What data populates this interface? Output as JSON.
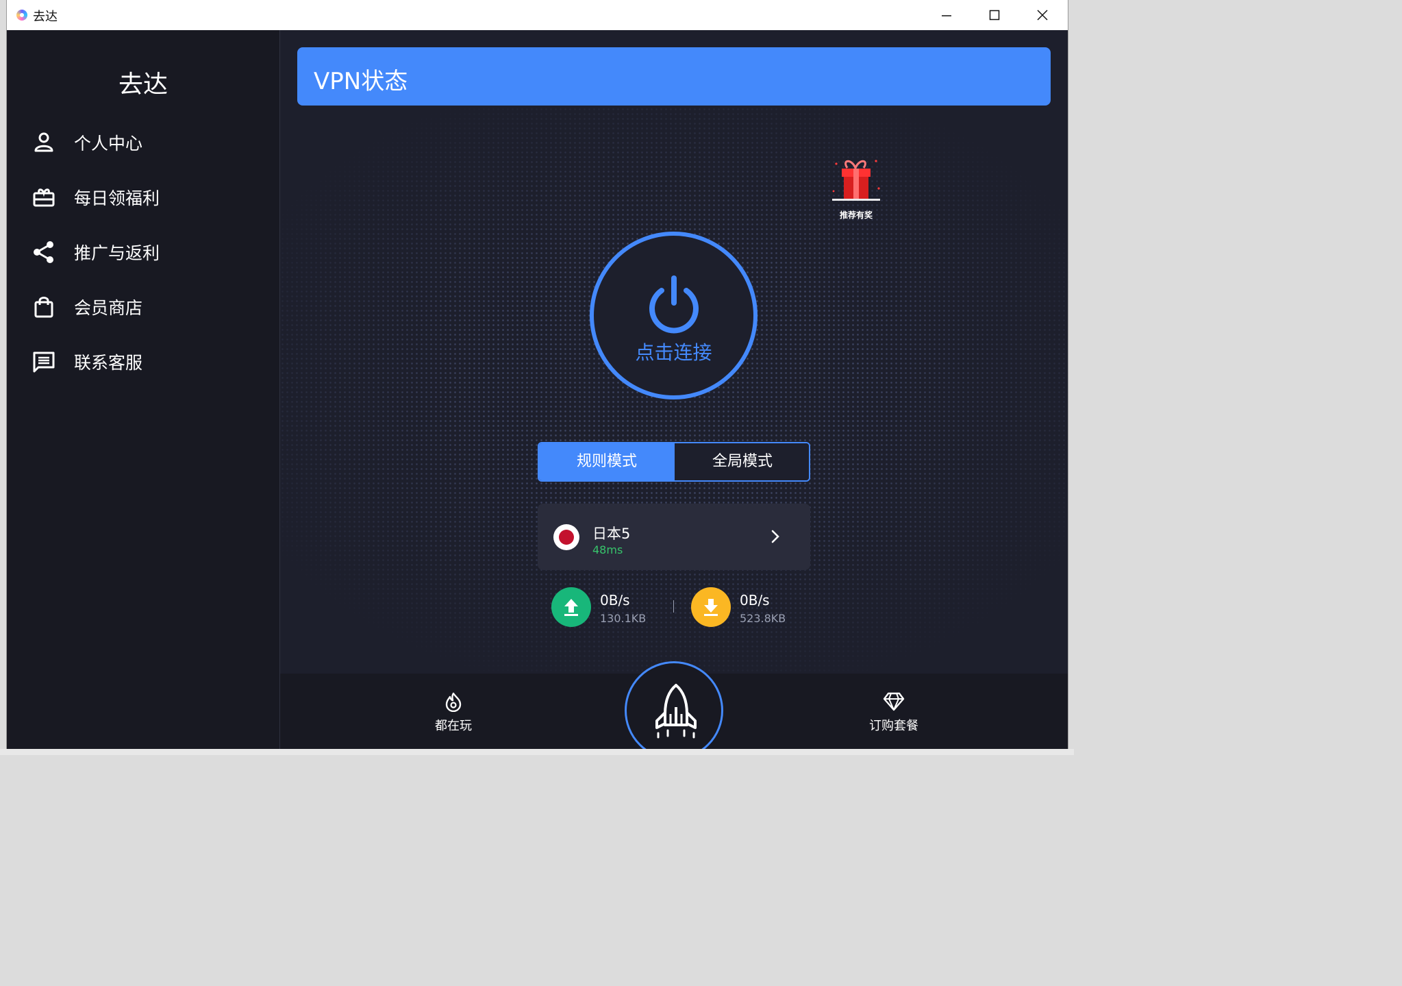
{
  "window": {
    "title": "去达"
  },
  "sidebar": {
    "brand": "去达",
    "items": [
      {
        "label": "个人中心",
        "icon": "person-icon"
      },
      {
        "label": "每日领福利",
        "icon": "gift-box-icon"
      },
      {
        "label": "推广与返利",
        "icon": "share-icon"
      },
      {
        "label": "会员商店",
        "icon": "shopping-bag-icon"
      },
      {
        "label": "联系客服",
        "icon": "chat-icon"
      }
    ]
  },
  "main": {
    "header_title": "VPN状态",
    "gift_label": "推荐有奖",
    "connect_label": "点击连接",
    "modes": [
      {
        "label": "规则模式",
        "active": true
      },
      {
        "label": "全局模式",
        "active": false
      }
    ],
    "server": {
      "name": "日本5",
      "ping": "48ms",
      "flag": "japan-flag"
    },
    "upload": {
      "rate": "0B/s",
      "total": "130.1KB"
    },
    "download": {
      "rate": "0B/s",
      "total": "523.8KB"
    }
  },
  "bottom_nav": {
    "play_label": "都在玩",
    "buy_label": "订购套餐"
  },
  "colors": {
    "accent": "#4489fb",
    "background": "#1d1f2c",
    "sidebar": "#181922",
    "upload": "#18b77a",
    "download": "#fbb723",
    "ping": "#37c46b"
  }
}
